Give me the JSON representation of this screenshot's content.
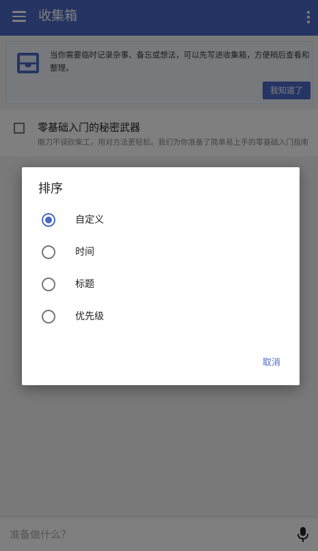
{
  "appbar": {
    "title": "收集箱",
    "icons": [
      "menu-icon",
      "more-vert-icon"
    ]
  },
  "tip": {
    "text": "当你需要临时记录杂事、备忘或想法，可以先写进收集箱，方便稍后查看和整理。",
    "button": "我知道了",
    "icon": "inbox-tray-icon"
  },
  "list": {
    "items": [
      {
        "title": "零基础入门的秘密武器",
        "desc": "磨刀不误砍柴工，用对方法更轻松。我们为你准备了简单易上手的零基础入门指南"
      }
    ]
  },
  "bottom_bar": {
    "placeholder": "准备做什么？",
    "icon": "mic-icon"
  },
  "dialog": {
    "title": "排序",
    "options": [
      {
        "label": "自定义",
        "selected": true
      },
      {
        "label": "时间",
        "selected": false
      },
      {
        "label": "标题",
        "selected": false
      },
      {
        "label": "优先级",
        "selected": false
      }
    ],
    "cancel": "取消"
  },
  "colors": {
    "primary": "#4a69c6",
    "scrim": "rgba(0,0,0,0.5)"
  }
}
